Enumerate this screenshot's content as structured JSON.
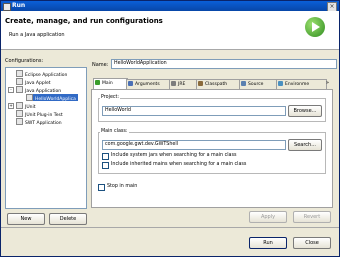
{
  "window": {
    "title": "Run",
    "close_glyph": "×"
  },
  "banner": {
    "heading": "Create, manage, and run configurations",
    "subtitle": "Run a Java application"
  },
  "configurations_label": "Configurations:",
  "tree": {
    "items": [
      {
        "label": "Eclipse Application"
      },
      {
        "label": "Java Applet"
      },
      {
        "label": "Java Application",
        "expander": "-"
      },
      {
        "label": "HelloWorldApplica"
      },
      {
        "label": "JUnit",
        "expander": "+"
      },
      {
        "label": "JUnit Plug-in Test"
      },
      {
        "label": "SWT Application"
      }
    ]
  },
  "left_buttons": {
    "new": "New",
    "delete": "Delete"
  },
  "name": {
    "label": "Name:",
    "value": "HelloWorldApplication"
  },
  "tabs": [
    "Main",
    "Arguments",
    "JRE",
    "Classpath",
    "Source",
    "Environme"
  ],
  "project": {
    "label": "Project:",
    "value": "HelloWorld",
    "browse": "Browse..."
  },
  "main_class": {
    "label": "Main class:",
    "value": "com.google.gwt.dev.GWTShell",
    "search": "Search..."
  },
  "checkboxes": {
    "include_system_jars": "Include system jars when searching for a main class",
    "include_inherited": "Include inherited mains when searching for a main class",
    "stop_in_main": "Stop in main"
  },
  "panel_buttons": {
    "apply": "Apply",
    "revert": "Revert"
  },
  "footer": {
    "run": "Run",
    "close": "Close"
  },
  "colors": {
    "title_bar": "#0a5fd8",
    "selection": "#316ac5",
    "run_icon": "#2e8b1e"
  }
}
